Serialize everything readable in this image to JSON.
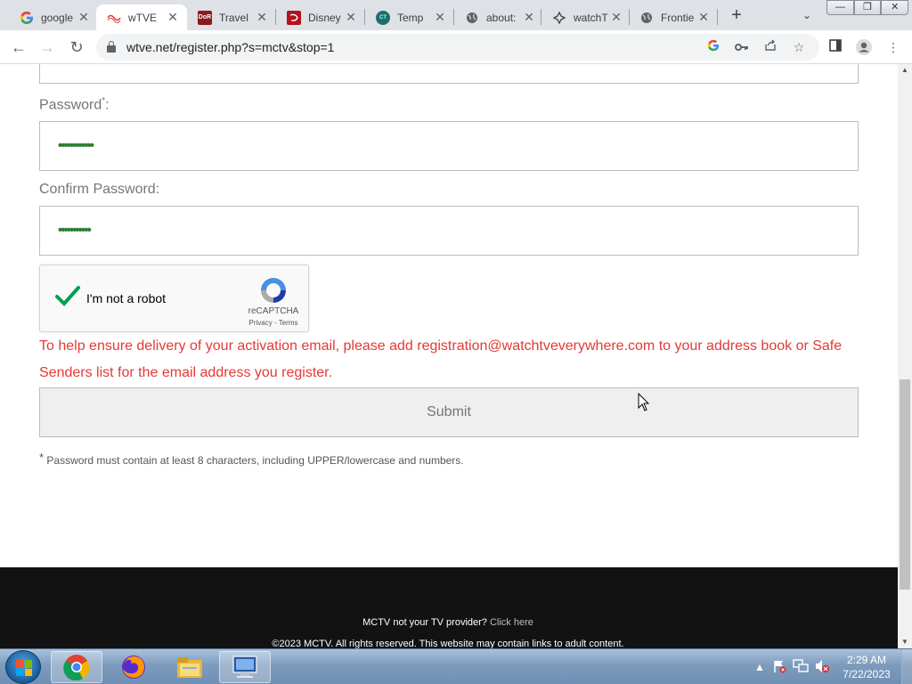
{
  "browser": {
    "tabs": [
      {
        "title": "google",
        "favicon": "google-g-icon"
      },
      {
        "title": "wTVE",
        "favicon": "wtve-icon",
        "active": true
      },
      {
        "title": "Travel",
        "favicon": "dor-icon"
      },
      {
        "title": "Disney",
        "favicon": "disney-icon"
      },
      {
        "title": "Temp",
        "favicon": "temp-icon"
      },
      {
        "title": "about:",
        "favicon": "globe-icon"
      },
      {
        "title": "watchT",
        "favicon": "puzzle-icon"
      },
      {
        "title": "Frontie",
        "favicon": "globe-icon"
      }
    ],
    "favicon_text": {
      "dor": "DoR",
      "temp": "CT"
    },
    "url": "wtve.net/register.php?s=mctv&stop=1",
    "window_controls": {
      "minimize": "—",
      "restore": "❐",
      "close": "✕"
    }
  },
  "form": {
    "password_label": "Password",
    "password_required_mark": "*",
    "password_label_colon": ":",
    "password_value": "••••••••••••",
    "confirm_label": "Confirm Password:",
    "confirm_value": "•••••••••••",
    "captcha": {
      "label": "I'm not a robot",
      "brand": "reCAPTCHA",
      "privacy": "Privacy",
      "separator": " - ",
      "terms": "Terms",
      "checked": true
    },
    "notice": "To help ensure delivery of your activation email, please add registration@watchtveverywhere.com to your address book or Safe Senders list for the email address you register.",
    "submit_label": "Submit",
    "footnote_mark": "*",
    "footnote": "Password must contain at least 8 characters, including UPPER/lowercase and numbers."
  },
  "footer": {
    "question": "MCTV not your TV provider?",
    "link": "Click here",
    "copyright": "©2023 MCTV. All rights reserved. This website may contain links to adult content."
  },
  "taskbar": {
    "apps": [
      "chrome-icon",
      "firefox-icon",
      "file-explorer-icon",
      "remote-desktop-icon"
    ],
    "time": "2:29 AM",
    "date": "7/22/2023"
  },
  "colors": {
    "notice": "#e53935",
    "password_dots": "#2e7d32",
    "footer_bg": "#121212"
  }
}
